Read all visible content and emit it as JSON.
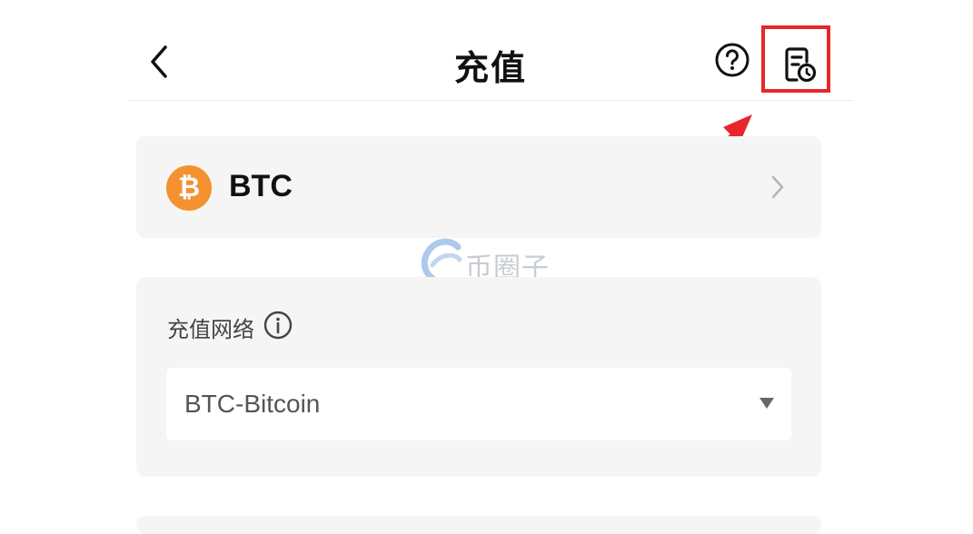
{
  "header": {
    "title": "充值",
    "back_icon": "chevron-left-icon",
    "help_icon": "question-circle-icon",
    "history_icon": "document-clock-icon"
  },
  "coin": {
    "name": "BTC",
    "icon_glyph": "₿",
    "icon_color": "#f3922f"
  },
  "network": {
    "label": "充值网络",
    "info_icon": "info-circle-icon",
    "selected": "BTC-Bitcoin"
  },
  "annotation": {
    "color": "#e8262a"
  },
  "watermark": {
    "text": "币圈子"
  }
}
